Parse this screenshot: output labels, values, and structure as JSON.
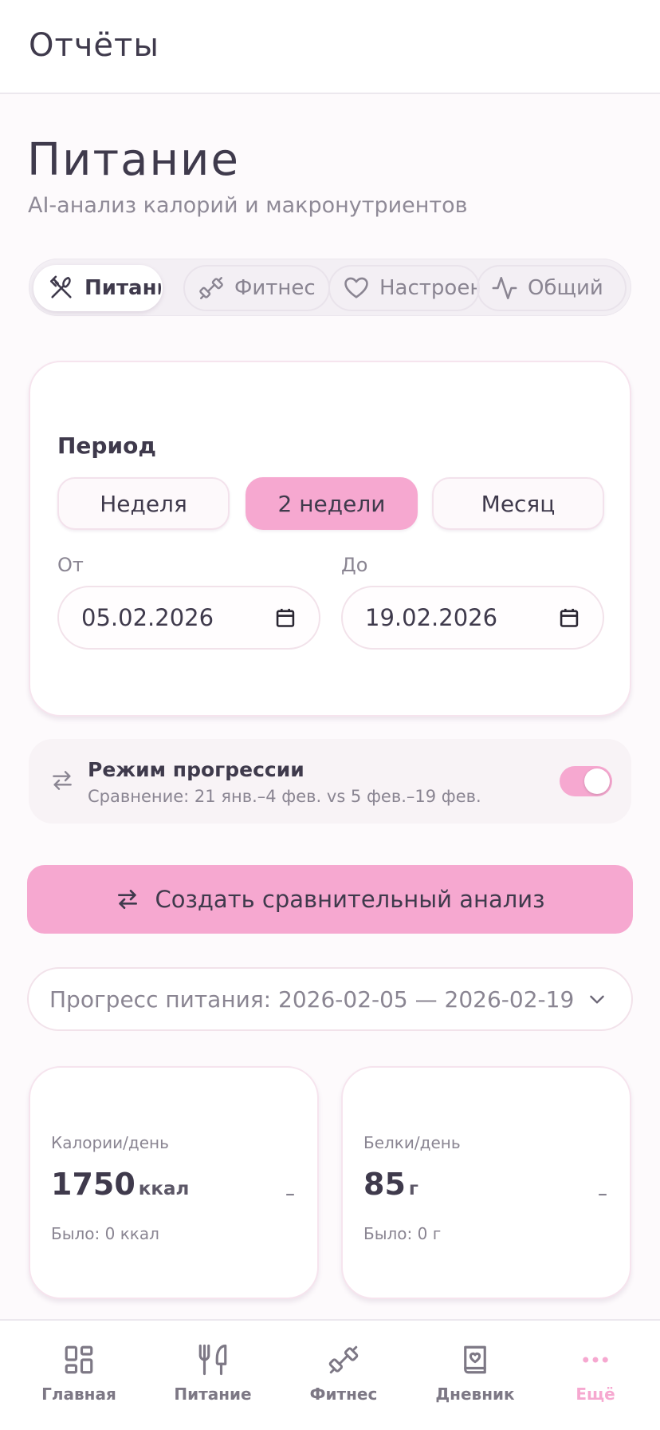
{
  "header": {
    "title": "Отчёты"
  },
  "page": {
    "title": "Питание",
    "subtitle": "AI-анализ калорий и макронутриентов"
  },
  "tabs": [
    {
      "label": "Питание",
      "icon": "fork-knife-crossed-icon",
      "active": true
    },
    {
      "label": "Фитнес",
      "icon": "dumbbell-icon",
      "active": false
    },
    {
      "label": "Настроение",
      "icon": "heart-icon",
      "active": false
    },
    {
      "label": "Общий",
      "icon": "activity-icon",
      "active": false
    }
  ],
  "period": {
    "label": "Период",
    "options": [
      "Неделя",
      "2 недели",
      "Месяц"
    ],
    "selected": "2 недели",
    "from_label": "От",
    "from_value": "05.02.2026",
    "to_label": "До",
    "to_value": "19.02.2026"
  },
  "progression": {
    "title": "Режим прогрессии",
    "subtitle": "Сравнение: 21 янв.–4 фев. vs 5 фев.–19 фев.",
    "enabled": true
  },
  "create_button": {
    "label": "Создать сравнительный анализ"
  },
  "report_select": {
    "value": "Прогресс питания: 2026-02-05 — 2026-02-19"
  },
  "stats": [
    {
      "label": "Калории/день",
      "value": "1750",
      "unit": "ккал",
      "trend": "–",
      "previous": "Было: 0 ккал"
    },
    {
      "label": "Белки/день",
      "value": "85",
      "unit": "г",
      "trend": "–",
      "previous": "Было: 0 г"
    }
  ],
  "nav": [
    {
      "label": "Главная",
      "icon": "grid-icon",
      "active": false
    },
    {
      "label": "Питание",
      "icon": "utensils-icon",
      "active": false
    },
    {
      "label": "Фитнес",
      "icon": "dumbbell-icon",
      "active": false
    },
    {
      "label": "Дневник",
      "icon": "journal-icon",
      "active": false
    },
    {
      "label": "Ещё",
      "icon": "more-dots-icon",
      "active": true
    }
  ],
  "colors": {
    "accent": "#f6a8d0",
    "text": "#3f3a4c",
    "muted": "#8a8592",
    "background": "#fdfafc"
  }
}
